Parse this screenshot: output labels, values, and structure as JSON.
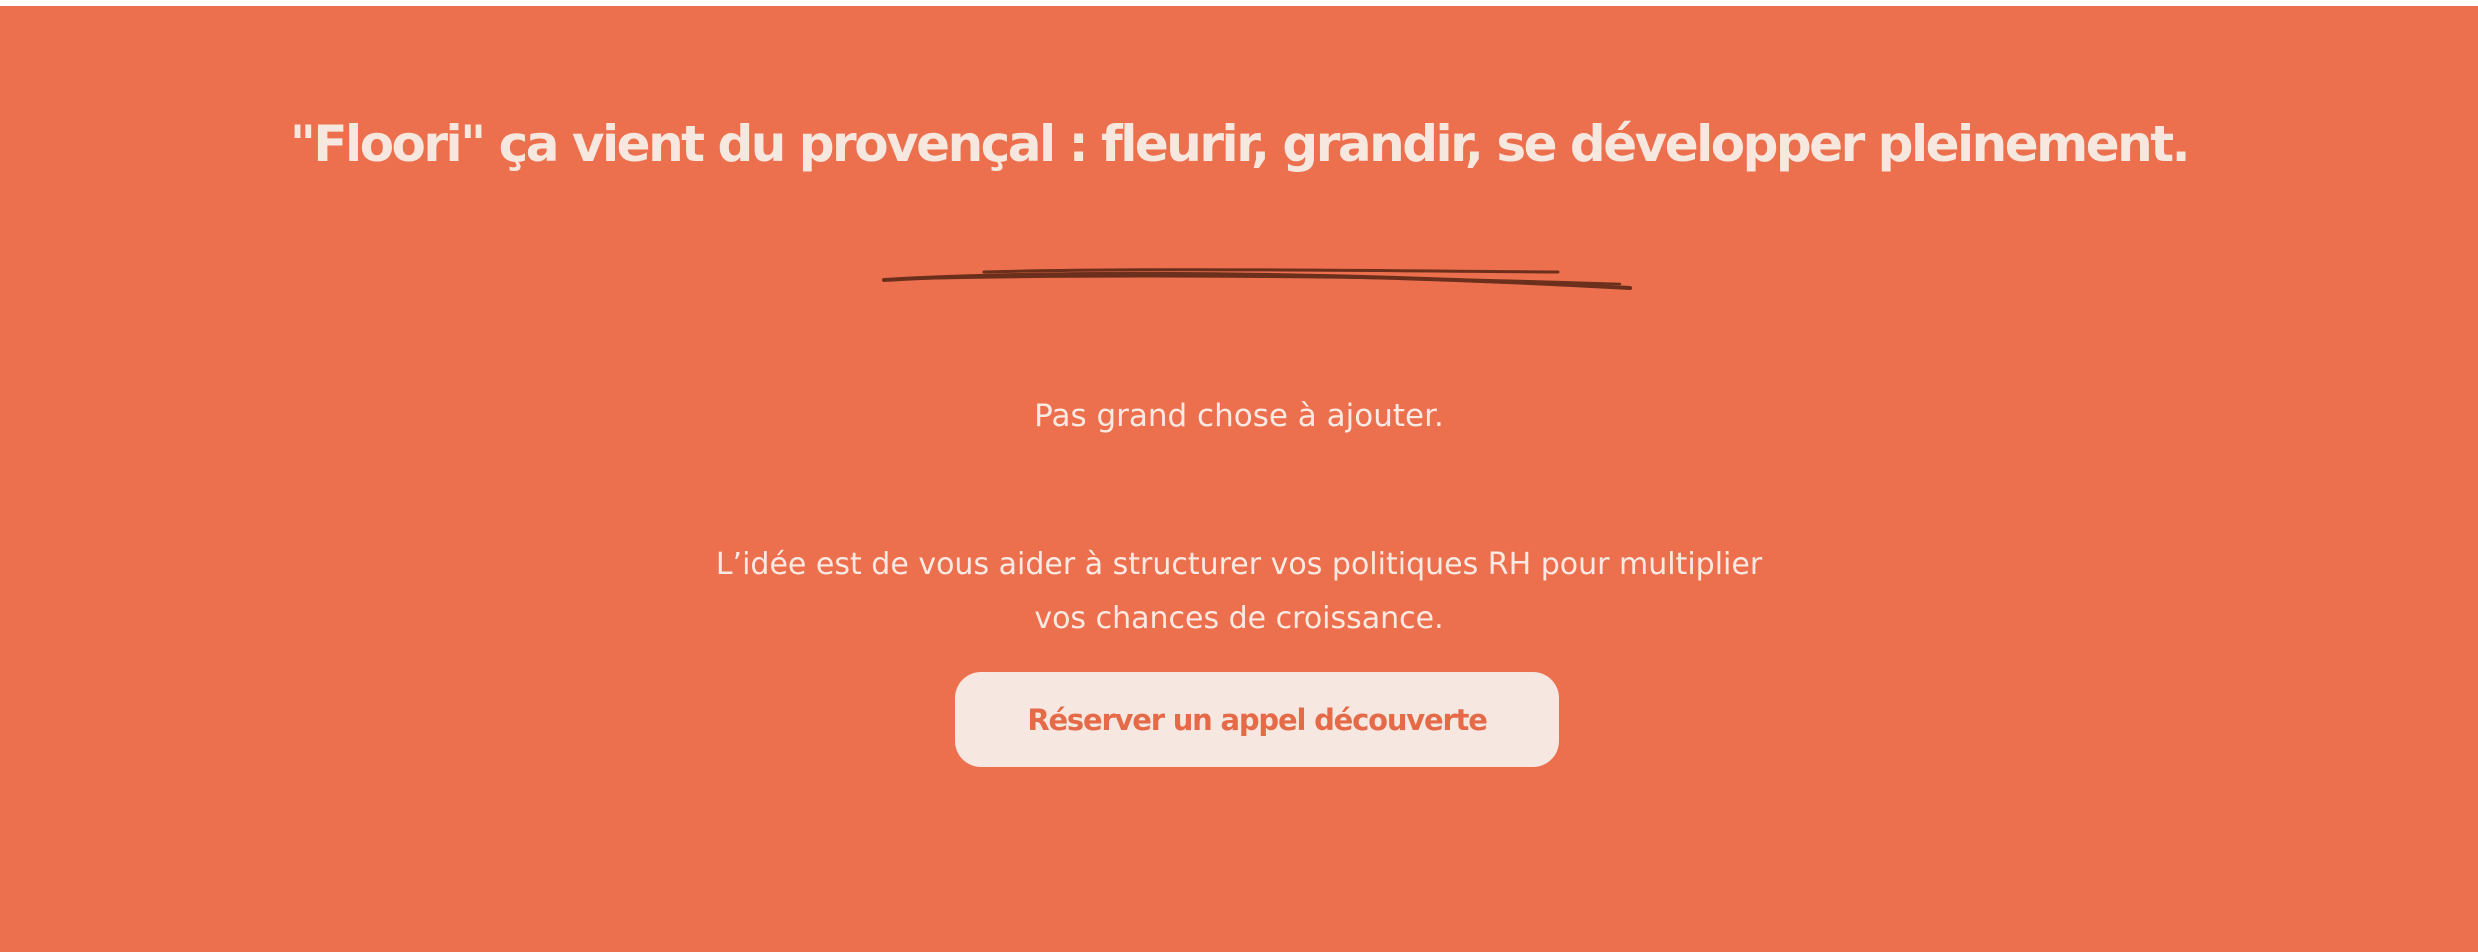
{
  "colors": {
    "background": "#ec704e",
    "headline_text": "#f6e7df",
    "body_text": "#fbeae3",
    "scribble": "#6b2f1c",
    "button_background": "#f6e7e1",
    "button_text": "#e56a47"
  },
  "hero": {
    "headline": "\"Floori\" ça vient du provençal : fleurir, grandir, se développer pleinement.",
    "underline_icon": "hand-drawn-underline-scribble",
    "lead": "Pas grand chose à ajouter.",
    "body": "L’idée est de vous aider à structurer vos politiques RH pour multiplier vos chances de croissance.",
    "cta_label": "Réserver un appel découverte"
  }
}
